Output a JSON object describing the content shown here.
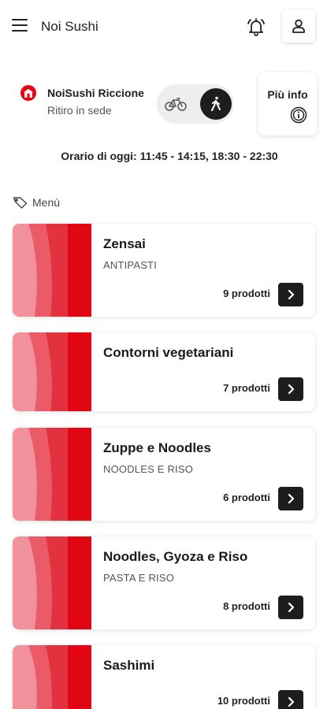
{
  "header": {
    "title": "Noi Sushi"
  },
  "store": {
    "name": "NoiSushi Riccione",
    "mode": "Ritiro in sede"
  },
  "info": {
    "label": "Più info"
  },
  "hours": "Orario di oggi: 11:45 - 14:15, 18:30 - 22:30",
  "menu_heading": "Menù",
  "categories": [
    {
      "title": "Zensai",
      "subtitle": "ANTIPASTI",
      "count": "9 prodotti"
    },
    {
      "title": "Contorni vegetariani",
      "subtitle": "",
      "count": "7 prodotti"
    },
    {
      "title": "Zuppe e Noodles",
      "subtitle": "NOODLES E RISO",
      "count": "6 prodotti"
    },
    {
      "title": "Noodles, Gyoza e Riso",
      "subtitle": "PASTA E RISO",
      "count": "8 prodotti"
    },
    {
      "title": "Sashimi",
      "subtitle": "",
      "count": "10 prodotti"
    }
  ],
  "colors": {
    "brand_red": "#e20613",
    "dark": "#1d1d1d"
  }
}
